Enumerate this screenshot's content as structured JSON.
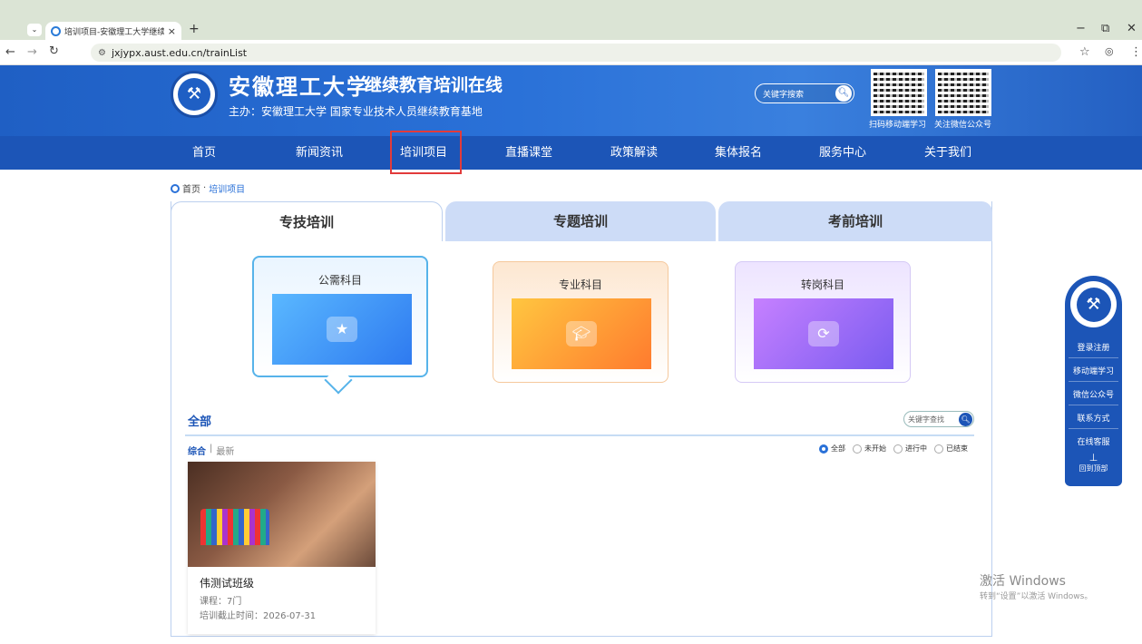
{
  "browser": {
    "tab_title": "培训项目-安徽理工大学继续教育",
    "url": "jxjypx.aust.edu.cn/trainList",
    "min": "−",
    "max": "⧉",
    "close": "✕"
  },
  "header": {
    "university": "安徽理工大学",
    "system": "继续教育培训在线",
    "host": "主办：安徽理工大学  国家专业技术人员继续教育基地",
    "search_placeholder": "关键字搜索",
    "qr1_label": "扫码移动端学习",
    "qr2_label": "关注微信公众号"
  },
  "nav": [
    "首页",
    "新闻资讯",
    "培训项目",
    "直播课堂",
    "政策解读",
    "集体报名",
    "服务中心",
    "关于我们"
  ],
  "breadcrumb": {
    "home": "首页",
    "sep": "·",
    "current": "培训项目"
  },
  "tabs": [
    "专技培训",
    "专题培训",
    "考前培训"
  ],
  "cards": [
    "公需科目",
    "专业科目",
    "转岗科目"
  ],
  "list": {
    "heading": "全部",
    "search_placeholder": "关键字查找",
    "sort": [
      "综合",
      "最新"
    ],
    "sort_sep": "|",
    "filters": [
      "全部",
      "未开始",
      "进行中",
      "已结束"
    ]
  },
  "course": {
    "name": "伟测试班级",
    "lessons": "课程：7门",
    "deadline": "培训截止时间：2026-07-31"
  },
  "side": [
    "登录注册",
    "移动端学习",
    "微信公众号",
    "联系方式",
    "在线客服"
  ],
  "side_top": "回到顶部",
  "watermark": {
    "title": "激活 Windows",
    "sub": "转到“设置”以激活 Windows。"
  }
}
